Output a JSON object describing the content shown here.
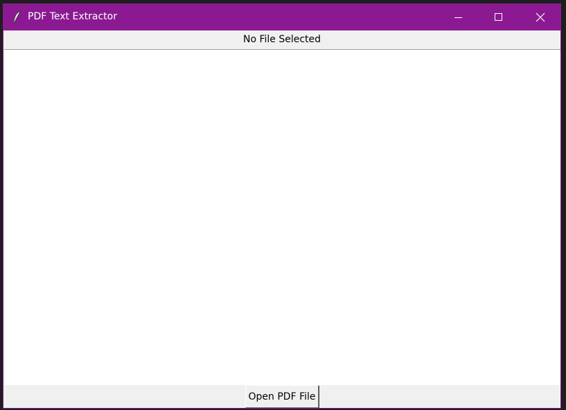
{
  "window": {
    "title": "PDF Text Extractor",
    "icon": "feather-icon",
    "accent_color": "#8b1a92",
    "controls": {
      "minimize": "minimize-icon",
      "maximize": "maximize-icon",
      "close": "close-icon"
    }
  },
  "status": {
    "label": "No File Selected"
  },
  "text_area": {
    "value": ""
  },
  "actions": {
    "open_pdf_label": "Open PDF File"
  }
}
